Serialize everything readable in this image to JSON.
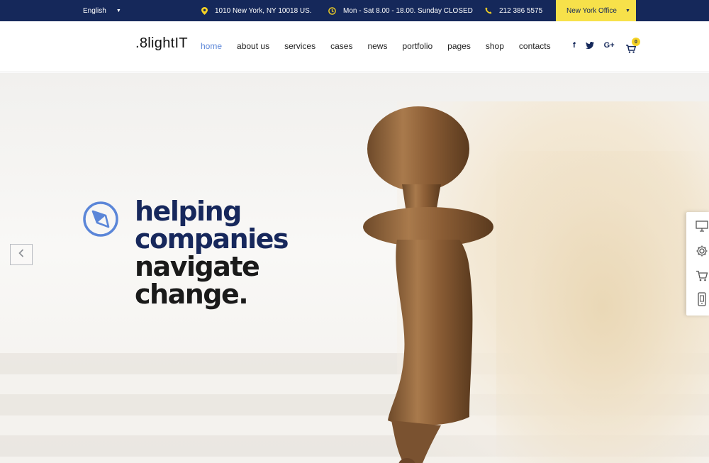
{
  "topbar": {
    "language": "English",
    "address": "1010 New York, NY 10018 US.",
    "hours": "Mon - Sat 8.00 - 18.00. Sunday CLOSED",
    "phone": "212 386 5575",
    "office": "New York Office"
  },
  "header": {
    "logo": ".8lightIT",
    "nav": [
      "home",
      "about us",
      "services",
      "cases",
      "news",
      "portfolio",
      "pages",
      "shop",
      "contacts"
    ],
    "social": {
      "facebook": "f",
      "google": "G+"
    },
    "cart_count": "0"
  },
  "hero": {
    "headline": [
      "helping",
      "companies",
      "navigate",
      "change."
    ]
  },
  "colors": {
    "navy": "#15285a",
    "accent_yellow": "#f7e14a",
    "nav_active": "#5b86d8"
  },
  "icons": {
    "topbar": [
      "map-pin-icon",
      "clock-icon",
      "phone-icon",
      "caret-down-icon"
    ],
    "header": [
      "facebook-icon",
      "twitter-icon",
      "google-plus-icon",
      "cart-icon"
    ],
    "hero": [
      "compass-icon",
      "chevron-left-icon"
    ],
    "side_panel": [
      "monitor-icon",
      "gear-icon",
      "cart-icon",
      "mobile-icon"
    ]
  }
}
